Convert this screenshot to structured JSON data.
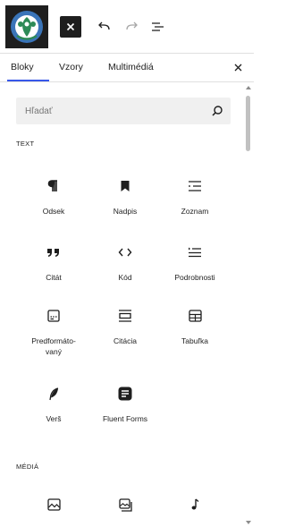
{
  "toolbar": {
    "logo": "site-logo",
    "close_icon": "close-icon",
    "undo_icon": "undo-icon",
    "redo_icon": "redo-icon",
    "document_overview_icon": "list-view-icon"
  },
  "tabs": {
    "items": [
      {
        "label": "Bloky",
        "active": true
      },
      {
        "label": "Vzory",
        "active": false
      },
      {
        "label": "Multimédiá",
        "active": false
      }
    ],
    "close_icon": "close-icon"
  },
  "search": {
    "placeholder": "Hľadať",
    "value": "",
    "icon": "search-icon"
  },
  "categories": {
    "text": {
      "label": "TEXT",
      "blocks": [
        {
          "label": "Odsek",
          "icon": "paragraph-icon"
        },
        {
          "label": "Nadpis",
          "icon": "heading-icon"
        },
        {
          "label": "Zoznam",
          "icon": "list-icon"
        },
        {
          "label": "Citát",
          "icon": "quote-icon"
        },
        {
          "label": "Kód",
          "icon": "code-icon"
        },
        {
          "label": "Podrobnosti",
          "icon": "details-icon"
        },
        {
          "label": "Predformáto-\nvaný",
          "icon": "preformatted-icon"
        },
        {
          "label": "Citácia",
          "icon": "pullquote-icon"
        },
        {
          "label": "Tabuľka",
          "icon": "table-icon"
        },
        {
          "label": "Verš",
          "icon": "verse-icon"
        },
        {
          "label": "Fluent Forms",
          "icon": "fluent-forms-icon"
        }
      ]
    },
    "media": {
      "label": "MÉDIÁ",
      "blocks": [
        {
          "icon": "image-icon"
        },
        {
          "icon": "gallery-icon"
        },
        {
          "icon": "audio-icon"
        }
      ]
    }
  },
  "colors": {
    "accent": "#3858e9",
    "dark": "#1e1e1e",
    "search_bg": "#f0f0f0",
    "logo_green": "#2e8b57",
    "logo_blue": "#3a74b8"
  }
}
